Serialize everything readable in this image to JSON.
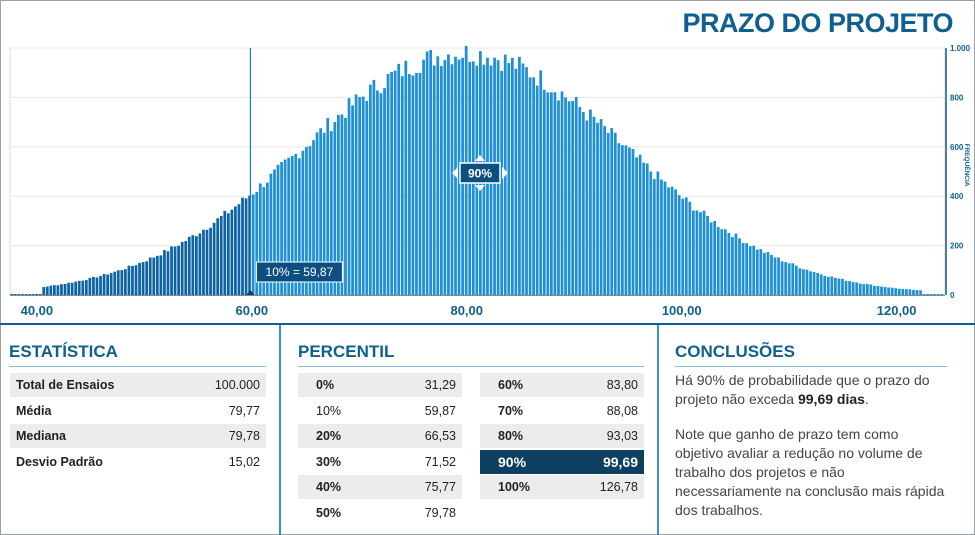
{
  "title": "PRAZO DO PROJETO",
  "colors": {
    "bar_light": "#1f8fd6",
    "bar_dark": "#0d63a5",
    "accent": "#0f5f8f",
    "highlight_row": "#0d3f62"
  },
  "chart_data": {
    "type": "bar",
    "x_ticks": [
      "40,00",
      "60,00",
      "80,00",
      "100,00",
      "120,00"
    ],
    "x_range": [
      37.5,
      124.5
    ],
    "y_ticks": [
      "1.000",
      "800",
      "600",
      "400",
      "200",
      "0"
    ],
    "y_range": [
      0,
      1000
    ],
    "ylabel": "FREQUÊNCIA",
    "mean": 79.77,
    "std": 15.02,
    "peak": 980,
    "cutoff_x": 59.87,
    "cutoff_label": "10% = 59,87",
    "band_label": "90%"
  },
  "estatistica": {
    "heading": "ESTATÍSTICA",
    "rows": [
      {
        "label": "Total de Ensaios",
        "value": "100.000"
      },
      {
        "label": "Média",
        "value": "79,77"
      },
      {
        "label": "Mediana",
        "value": "79,78"
      },
      {
        "label": "Desvio Padrão",
        "value": "15,02"
      }
    ]
  },
  "percentil": {
    "heading": "PERCENTIL",
    "col1": [
      {
        "label": "0%",
        "value": "31,29"
      },
      {
        "label": "10%",
        "value": "59,87"
      },
      {
        "label": "20%",
        "value": "66,53"
      },
      {
        "label": "30%",
        "value": "71,52"
      },
      {
        "label": "40%",
        "value": "75,77"
      },
      {
        "label": "50%",
        "value": "79,78"
      }
    ],
    "col2": [
      {
        "label": "60%",
        "value": "83,80"
      },
      {
        "label": "70%",
        "value": "88,08"
      },
      {
        "label": "80%",
        "value": "93,03"
      },
      {
        "label": "90%",
        "value": "99,69"
      },
      {
        "label": "100%",
        "value": "126,78"
      }
    ]
  },
  "conclusoes": {
    "heading": "CONCLUSÕES",
    "p1_pre": "Há 90% de probabilidade que o prazo do projeto não exceda ",
    "p1_bold": "99,69 dias",
    "p1_post": ".",
    "p2": "Note que ganho de prazo tem como objetivo avaliar a redução no volume de trabalho dos projetos e não necessariamente na conclusão mais rápida dos trabalhos."
  }
}
